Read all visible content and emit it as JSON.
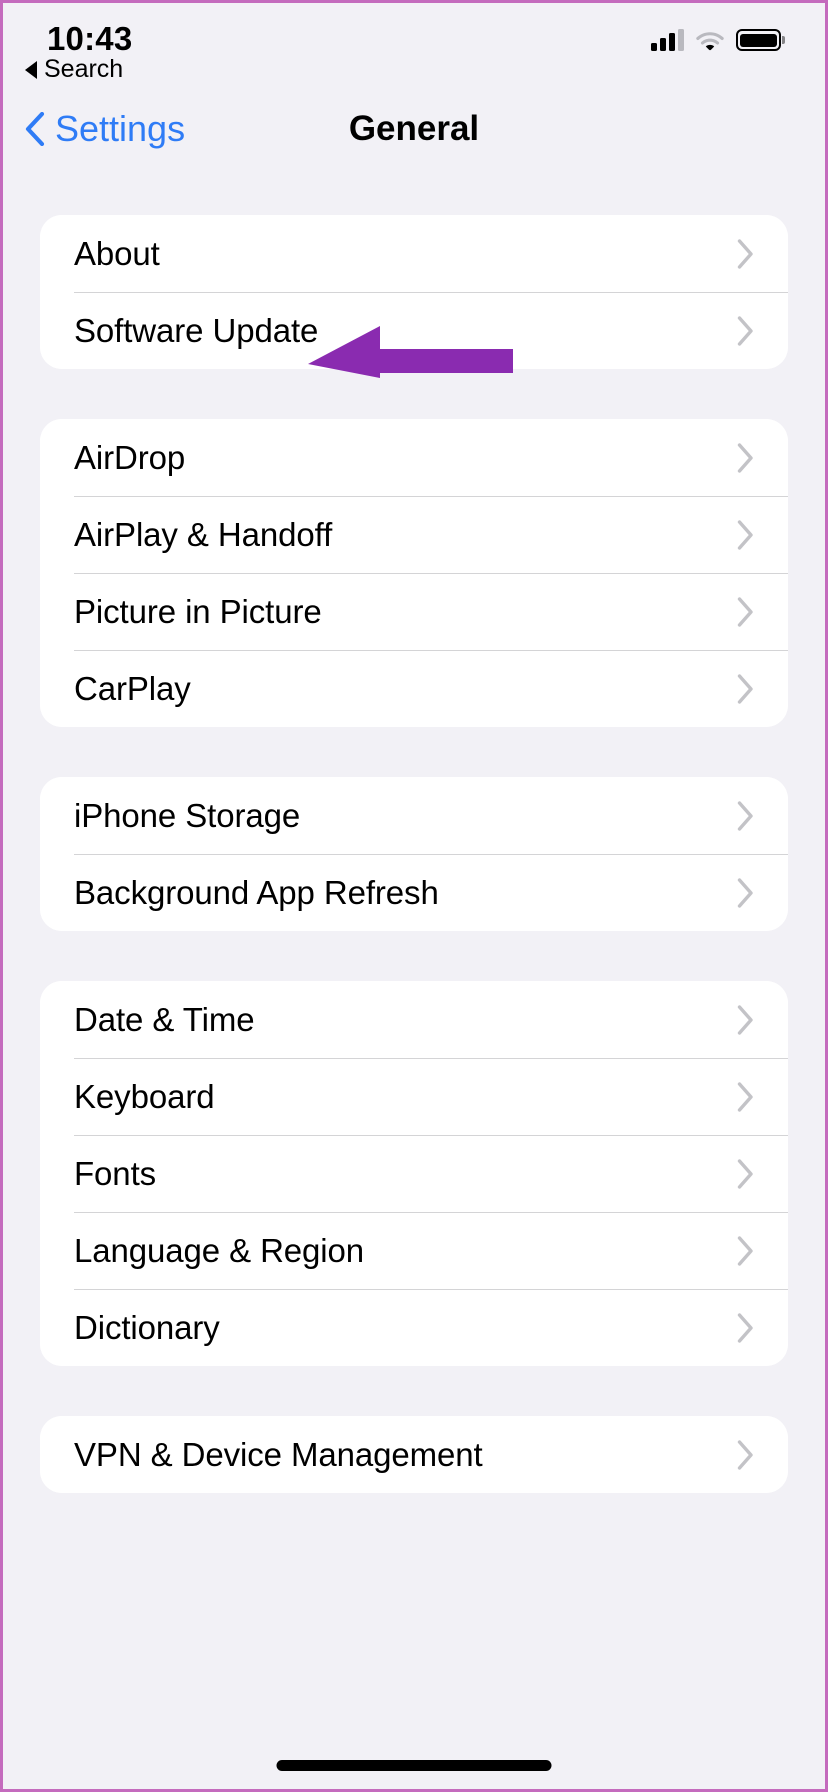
{
  "status_bar": {
    "time": "10:43",
    "cellular_icon": "cellular-signal-icon",
    "wifi_icon": "wifi-icon",
    "battery_icon": "battery-full-icon"
  },
  "back_to_app": {
    "label": "Search",
    "icon": "back-triangle-icon"
  },
  "nav_bar": {
    "back_label": "Settings",
    "back_icon": "chevron-left-icon",
    "title": "General",
    "tint_color": "#2f7cf6"
  },
  "annotation": {
    "type": "arrow-left",
    "color": "#8a2bb0",
    "points_at": "Software Update"
  },
  "groups": [
    {
      "rows": [
        {
          "label": "About",
          "accessory": "chevron-right-icon"
        },
        {
          "label": "Software Update",
          "accessory": "chevron-right-icon"
        }
      ]
    },
    {
      "rows": [
        {
          "label": "AirDrop",
          "accessory": "chevron-right-icon"
        },
        {
          "label": "AirPlay & Handoff",
          "accessory": "chevron-right-icon"
        },
        {
          "label": "Picture in Picture",
          "accessory": "chevron-right-icon"
        },
        {
          "label": "CarPlay",
          "accessory": "chevron-right-icon"
        }
      ]
    },
    {
      "rows": [
        {
          "label": "iPhone Storage",
          "accessory": "chevron-right-icon"
        },
        {
          "label": "Background App Refresh",
          "accessory": "chevron-right-icon"
        }
      ]
    },
    {
      "rows": [
        {
          "label": "Date & Time",
          "accessory": "chevron-right-icon"
        },
        {
          "label": "Keyboard",
          "accessory": "chevron-right-icon"
        },
        {
          "label": "Fonts",
          "accessory": "chevron-right-icon"
        },
        {
          "label": "Language & Region",
          "accessory": "chevron-right-icon"
        },
        {
          "label": "Dictionary",
          "accessory": "chevron-right-icon"
        }
      ]
    },
    {
      "rows": [
        {
          "label": "VPN & Device Management",
          "accessory": "chevron-right-icon"
        }
      ]
    }
  ],
  "home_indicator": "home-indicator-bar",
  "colors": {
    "page_background": "#f2f1f6",
    "card_background": "#ffffff",
    "separator": "#d4d4d6",
    "chevron": "#c3c3c7",
    "accent_blue": "#2f7cf6",
    "annotation_purple": "#8a2bb0",
    "frame_border": "#c46bbd"
  }
}
